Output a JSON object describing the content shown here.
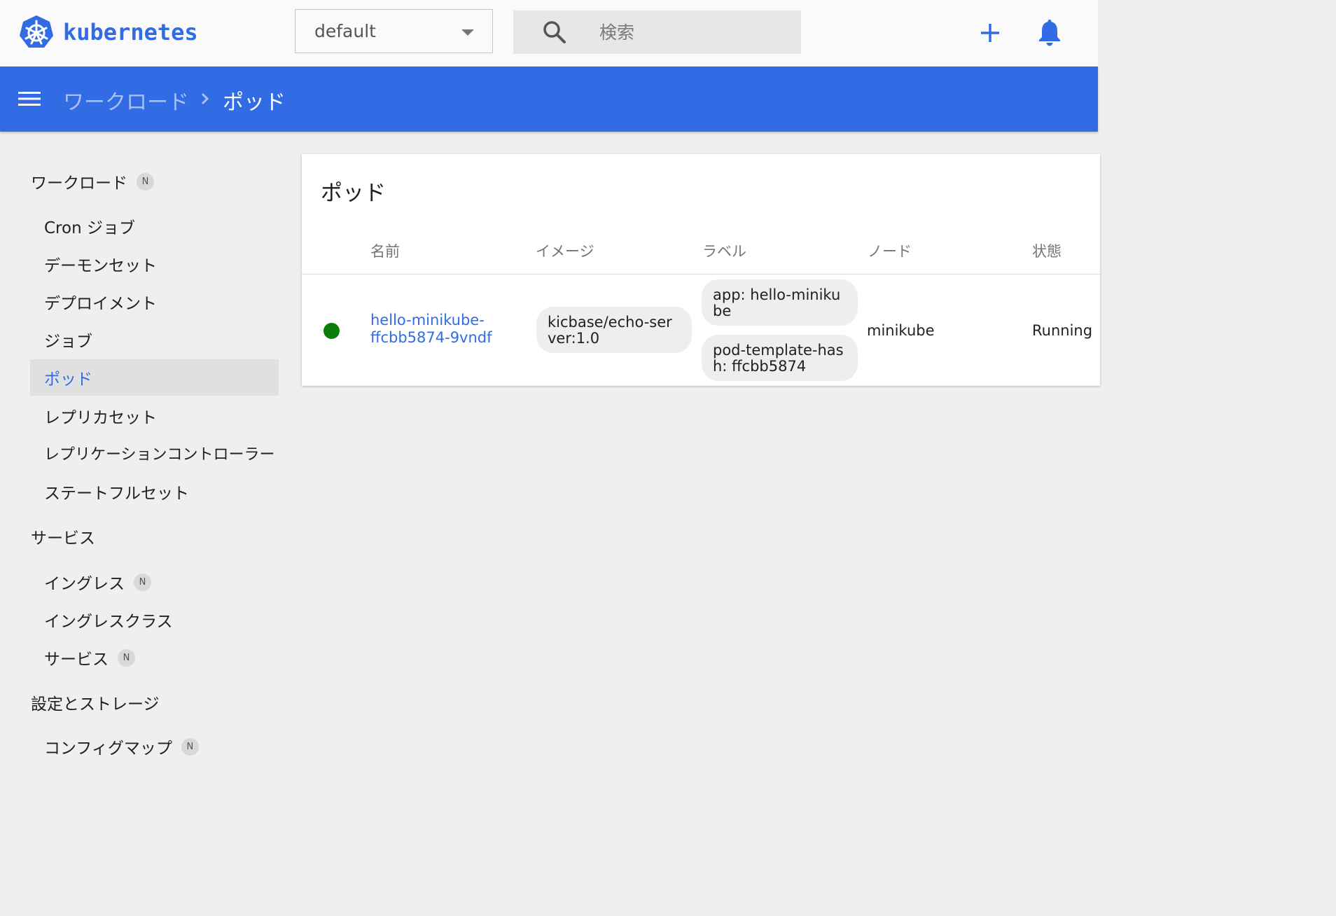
{
  "app": {
    "logo_text": "kubernetes"
  },
  "namespace": {
    "selected": "default"
  },
  "search": {
    "placeholder": "検索"
  },
  "breadcrumb": {
    "parent": "ワークロード",
    "current": "ポッド"
  },
  "sidebar": {
    "workloads": {
      "label": "ワークロード",
      "badge": "N"
    },
    "workload_items": [
      {
        "label": "Cron ジョブ"
      },
      {
        "label": "デーモンセット"
      },
      {
        "label": "デプロイメント"
      },
      {
        "label": "ジョブ"
      },
      {
        "label": "ポッド",
        "active": true
      },
      {
        "label": "レプリカセット"
      },
      {
        "label": "レプリケーションコントローラー"
      },
      {
        "label": "ステートフルセット"
      }
    ],
    "service": {
      "label": "サービス"
    },
    "service_items": [
      {
        "label": "イングレス",
        "badge": "N"
      },
      {
        "label": "イングレスクラス"
      },
      {
        "label": "サービス",
        "badge": "N"
      }
    ],
    "config": {
      "label": "設定とストレージ"
    },
    "config_items": [
      {
        "label": "コンフィグマップ",
        "badge": "N"
      }
    ]
  },
  "pods": {
    "title": "ポッド",
    "columns": [
      "名前",
      "イメージ",
      "ラベル",
      "ノード",
      "状態"
    ],
    "rows": [
      {
        "name": "hello-minikube-ffcbb5874-9vndf",
        "image": "kicbase/echo-server:1.0",
        "labels": [
          "app: hello-minikube",
          "pod-template-hash: ffcbb5874"
        ],
        "node": "minikube",
        "status": "Running",
        "status_color": "#0a7d0a"
      }
    ]
  },
  "colors": {
    "accent": "#326ce5",
    "running": "#0a7d0a"
  }
}
